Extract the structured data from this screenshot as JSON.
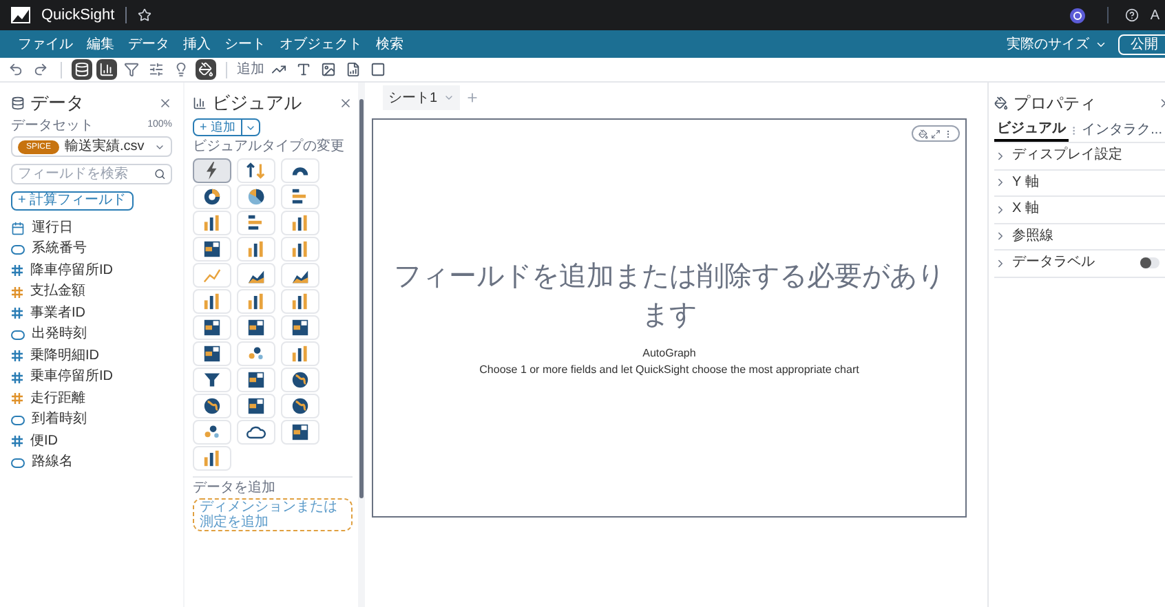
{
  "topbar": {
    "app_name": "QuickSight",
    "user_initial": "A"
  },
  "menu": [
    "ファイル",
    "編集",
    "データ",
    "挿入",
    "シート",
    "オブジェクト",
    "検索"
  ],
  "menu_right": {
    "size_dropdown": "実際のサイズ",
    "publish_button": "公開"
  },
  "toolbar": [
    {
      "kind": "undo",
      "selected": false
    },
    {
      "kind": "redo",
      "selected": false
    },
    {
      "kind": "data",
      "selected": true
    },
    {
      "kind": "visual",
      "selected": true
    },
    {
      "kind": "filter",
      "selected": false
    },
    {
      "kind": "parameters",
      "selected": false
    },
    {
      "kind": "insights",
      "selected": false
    },
    {
      "kind": "properties",
      "selected": true
    }
  ],
  "add_label": "追加",
  "add_tools": [
    {
      "kind": "line"
    },
    {
      "kind": "text"
    },
    {
      "kind": "image"
    },
    {
      "kind": "insight"
    },
    {
      "kind": "embed"
    }
  ],
  "data_panel": {
    "title": "データ",
    "dataset_label": "データセット",
    "dataset_percent": "100%",
    "spice_badge": "SPICE",
    "dataset": "輸送実績.csv",
    "search_placeholder": "フィールドを検索",
    "calc_field_button": "+ 計算フィールド",
    "fields": [
      {
        "kind": "date",
        "name": "運行日"
      },
      {
        "kind": "text",
        "name": "系統番号"
      },
      {
        "kind": "number",
        "name": "降車停留所ID",
        "color": "#2a7db5"
      },
      {
        "kind": "number",
        "name": "支払金額",
        "color": "#e0922b"
      },
      {
        "kind": "number",
        "name": "事業者ID",
        "color": "#2a7db5"
      },
      {
        "kind": "text",
        "name": "出発時刻"
      },
      {
        "kind": "number",
        "name": "乗降明細ID",
        "color": "#2a7db5"
      },
      {
        "kind": "number",
        "name": "乗車停留所ID",
        "color": "#2a7db5"
      },
      {
        "kind": "number",
        "name": "走行距離",
        "color": "#e0922b"
      },
      {
        "kind": "text",
        "name": "到着時刻"
      },
      {
        "kind": "number",
        "name": "便ID",
        "color": "#2a7db5"
      },
      {
        "kind": "text",
        "name": "路線名"
      }
    ]
  },
  "visual_panel": {
    "title": "ビジュアル",
    "add_button": "+ 追加",
    "type_label": "ビジュアルタイプの変更",
    "visual_types": [
      {
        "kind": "auto",
        "selected": true
      },
      {
        "kind": "kpi",
        "selected": false
      },
      {
        "kind": "gauge",
        "selected": false
      },
      {
        "kind": "donut",
        "selected": false
      },
      {
        "kind": "pie",
        "selected": false
      },
      {
        "kind": "hbar",
        "selected": false
      },
      {
        "kind": "vbar",
        "selected": false
      },
      {
        "kind": "hbar",
        "selected": false
      },
      {
        "kind": "vbar",
        "selected": false
      },
      {
        "kind": "table",
        "selected": false
      },
      {
        "kind": "vbar",
        "selected": false
      },
      {
        "kind": "vbar",
        "selected": false
      },
      {
        "kind": "line",
        "selected": false
      },
      {
        "kind": "area",
        "selected": false
      },
      {
        "kind": "area",
        "selected": false
      },
      {
        "kind": "vbar",
        "selected": false
      },
      {
        "kind": "vbar",
        "selected": false
      },
      {
        "kind": "vbar",
        "selected": false
      },
      {
        "kind": "table",
        "selected": false
      },
      {
        "kind": "table",
        "selected": false
      },
      {
        "kind": "table",
        "selected": false
      },
      {
        "kind": "table",
        "selected": false
      },
      {
        "kind": "scatter",
        "selected": false
      },
      {
        "kind": "vbar",
        "selected": false
      },
      {
        "kind": "funnel",
        "selected": false
      },
      {
        "kind": "table",
        "selected": false
      },
      {
        "kind": "globe",
        "selected": false
      },
      {
        "kind": "globe",
        "selected": false
      },
      {
        "kind": "table",
        "selected": false
      },
      {
        "kind": "globe",
        "selected": false
      },
      {
        "kind": "scatter",
        "selected": false
      },
      {
        "kind": "cloud",
        "selected": false
      },
      {
        "kind": "table",
        "selected": false
      },
      {
        "kind": "vbar",
        "selected": false
      }
    ],
    "add_data_label": "データを追加",
    "add_data_placeholder": "ディメンションまたは測定を追加"
  },
  "sheet_tabs": [
    {
      "label": "シート1",
      "selected": true
    }
  ],
  "canvas": {
    "message": "フィールドを追加または削除する必要があります",
    "visual_type": "AutoGraph",
    "hint": "Choose 1 or more fields and let QuickSight choose the most appropriate chart"
  },
  "properties": {
    "title": "プロパティ",
    "tabs": [
      {
        "label": "ビジュアル",
        "selected": true
      },
      {
        "label": "インタラク...",
        "selected": false
      }
    ],
    "sections": [
      {
        "label": "ディスプレイ設定"
      },
      {
        "label": "Y 軸"
      },
      {
        "label": "X 軸"
      },
      {
        "label": "参照線"
      },
      {
        "label": "データラベル",
        "toggle": {
          "on": false
        }
      }
    ]
  }
}
